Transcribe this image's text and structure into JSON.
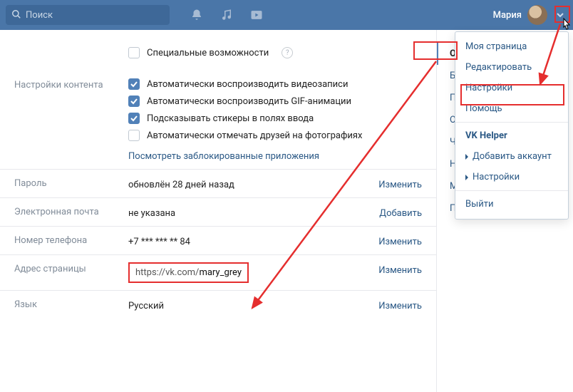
{
  "top": {
    "search_placeholder": "Поиск",
    "username": "Мария"
  },
  "accessibility": {
    "label": "Специальные возможности"
  },
  "content_settings": {
    "label": "Настройки контента",
    "opts": {
      "autoplay_video": "Автоматически воспроизводить видеозаписи",
      "autoplay_gif": "Автоматически воспроизводить GIF-анимации",
      "suggest_stickers": "Подсказывать стикеры в полях ввода",
      "autotag_friends": "Автоматически отмечать друзей на фотографиях"
    },
    "blocked_apps": "Посмотреть заблокированные приложения"
  },
  "password": {
    "label": "Пароль",
    "value": "обновлён 28 дней назад",
    "action": "Изменить"
  },
  "email": {
    "label": "Электронная почта",
    "value": "не указана",
    "action": "Добавить"
  },
  "phone": {
    "label": "Номер телефона",
    "value": "+7 *** *** ** 84",
    "action": "Изменить"
  },
  "address": {
    "label": "Адрес страницы",
    "prefix": "https://vk.com/",
    "suffix": "mary_grey",
    "action": "Изменить"
  },
  "language": {
    "label": "Язык",
    "value": "Русский",
    "action": "Изменить"
  },
  "side_tabs": {
    "general": "Общее",
    "security": "Безопасность",
    "privacy": "Приватность",
    "notifications": "Оповещения",
    "blacklist": "Чёрный список",
    "app_settings": "Настройки приложений",
    "mobile": "Мобильные устройства",
    "payments": "Платежи и переводы"
  },
  "menu": {
    "my_page": "Моя страница",
    "edit": "Редактировать",
    "settings": "Настройки",
    "help": "Помощь",
    "vk_helper": "VK Helper",
    "add_account": "Добавить аккаунт",
    "vh_settings": "Настройки",
    "logout": "Выйти"
  }
}
